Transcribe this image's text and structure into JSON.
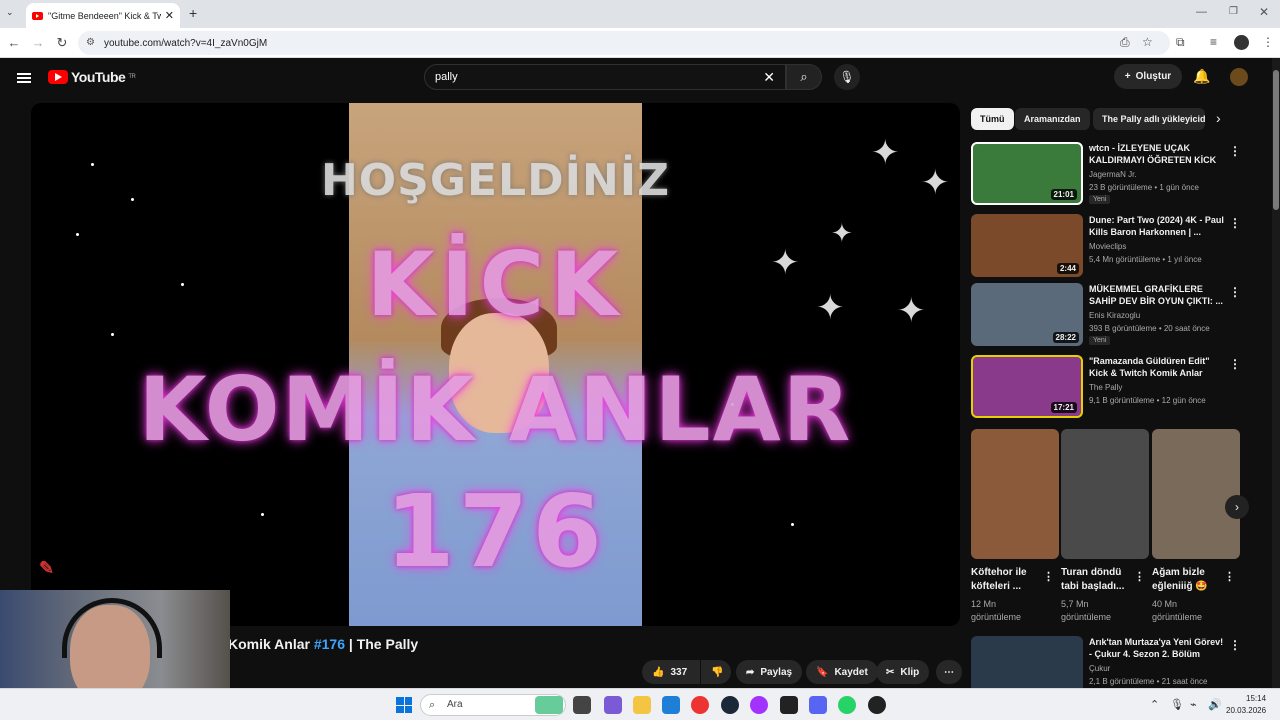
{
  "browser": {
    "tab_title": "\"Gitme Bendeeen\" Kick & Twitch",
    "url": "youtube.com/watch?v=4I_zaVn0GjM"
  },
  "header": {
    "logo": "YouTube",
    "logo_region": "TR",
    "search_value": "pally",
    "create_label": "Oluştur"
  },
  "video": {
    "overlay_welcome": "HOŞGELDİNİZ",
    "overlay_line1": "KİCK",
    "overlay_line2": "KOMİK ANLAR",
    "overlay_line3": "176",
    "title_prefix": "Komik Anlar ",
    "title_hashtag": "#176",
    "title_suffix": " | The Pally",
    "likes": "337",
    "share_label": "Paylaş",
    "save_label": "Kaydet",
    "clip_label": "Klip"
  },
  "chips": [
    "Tümü",
    "Aramanızdan",
    "The Pally adlı yükleyicid"
  ],
  "recommendations": [
    {
      "title": "wtcn - İZLEYENE UÇAK KALDIRMAYI ÖĞRETEN KİCK ...",
      "channel": "JagermaN Jr.",
      "meta": "23 B görüntüleme • 1 gün önce",
      "badge": "Yeni",
      "duration": "21:01",
      "thumb_color": "#3a7a3a"
    },
    {
      "title": "Dune: Part Two (2024) 4K - Paul Kills Baron Harkonnen | ...",
      "channel": "Movieclips",
      "meta": "5,4 Mn görüntüleme • 1 yıl önce",
      "badge": "",
      "duration": "2:44",
      "thumb_color": "#7a4a2a"
    },
    {
      "title": "MÜKEMMEL GRAFİKLERE SAHİP DEV BİR OYUN ÇIKTI: ...",
      "channel": "Enis Kirazoglu",
      "meta": "393 B görüntüleme • 20 saat önce",
      "badge": "Yeni",
      "duration": "28:22",
      "thumb_color": "#5a6a7a"
    },
    {
      "title": "\"Ramazanda Güldüren Edit\" Kick & Twitch Komik Anlar #175 | ...",
      "channel": "The Pally",
      "meta": "9,1 B görüntüleme • 12 gün önce",
      "badge": "",
      "duration": "17:21",
      "thumb_color": "#8a3a8a"
    }
  ],
  "shorts": [
    {
      "title": "Köftehor ile köfteleri ...",
      "views": "12 Mn görüntüleme",
      "thumb_color": "#8a5a3a"
    },
    {
      "title": "Turan döndü tabi başladı...",
      "views": "5,7 Mn görüntüleme",
      "thumb_color": "#4a4a4a"
    },
    {
      "title": "Ağam bizle eğleniiiğ 🤩",
      "views": "40 Mn görüntüleme",
      "thumb_color": "#7a6a5a"
    }
  ],
  "rec5": {
    "title": "Arık'tan Murtaza'ya Yeni Görev! - Çukur 4. Sezon 2. Bölüm",
    "channel": "Çukur",
    "meta": "2,1 B görüntüleme • 21 saat önce"
  },
  "taskbar": {
    "search_placeholder": "Ara",
    "time": "15:14",
    "date": "20.03.2026"
  }
}
